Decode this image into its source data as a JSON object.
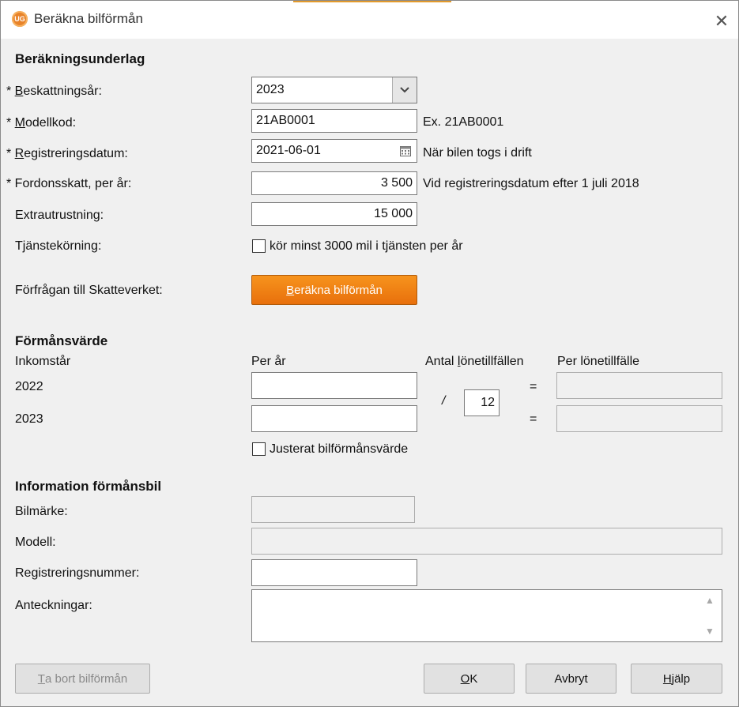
{
  "window": {
    "title": "Beräkna bilförmån",
    "app_icon_text": "UG"
  },
  "section1": {
    "heading": "Beräkningsunderlag",
    "tax_year": {
      "label_prefix": "* ",
      "label_key": "B",
      "label_rest": "eskattningsår",
      "value": "2023"
    },
    "model_code": {
      "label_prefix": "* ",
      "label_key": "M",
      "label_rest": "odellkod",
      "value": "21AB0001",
      "hint": "Ex. 21AB0001"
    },
    "reg_date": {
      "label_prefix": "* ",
      "label_key": "R",
      "label_rest": "egistreringsdatum",
      "value": "2021-06-01",
      "hint": "När bilen togs i drift"
    },
    "vehicle_tax": {
      "label": "* Fordonsskatt, per år:",
      "value": "3 500",
      "hint": "Vid registreringsdatum efter 1 juli 2018"
    },
    "extra_equipment": {
      "label": "Extrautrustning:",
      "value": "15 000"
    },
    "service_driving": {
      "label": "Tjänstekörning:",
      "checkbox_label": "kör minst 3000 mil i tjänsten per år"
    },
    "request": {
      "label": "Förfrågan till Skatteverket:",
      "button_key": "B",
      "button_rest": "eräkna bilförmån"
    }
  },
  "section2": {
    "heading": "Förmånsvärde",
    "col_income_year": "Inkomstår",
    "col_per_year": "Per år",
    "col_count_pre": "Antal ",
    "col_count_key": "l",
    "col_count_post": "önetillfällen",
    "col_per_payment": "Per lönetillfälle",
    "years": [
      "2022",
      "2023"
    ],
    "divider": "/",
    "payment_count": "12",
    "equals": "=",
    "adjusted_label": "Justerat bilförmånsvärde"
  },
  "section3": {
    "heading": "Information förmånsbil",
    "brand_label": "Bilmärke:",
    "model_label": "Modell:",
    "regnr_label": "Registreringsnummer:",
    "notes_label": "Anteckningar:"
  },
  "buttons": {
    "remove_key": "T",
    "remove_rest": "a bort bilförmån",
    "ok_key": "O",
    "ok_rest": "K",
    "cancel": "Avbryt",
    "help_key": "H",
    "help_rest": "jälp"
  }
}
